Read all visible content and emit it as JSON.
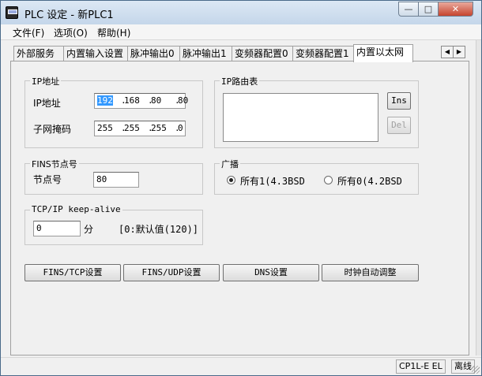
{
  "window": {
    "title": "PLC 设定 - 新PLC1",
    "minimize_glyph": "—",
    "maximize_glyph": "□",
    "close_glyph": "✕"
  },
  "menu": {
    "items": [
      "文件(F)",
      "选项(O)",
      "帮助(H)"
    ]
  },
  "tabs": {
    "items": [
      "外部服务",
      "内置输入设置",
      "脉冲输出0",
      "脉冲输出1",
      "变频器配置0",
      "变频器配置1",
      "内置以太网"
    ],
    "active_index": 6,
    "scroll_left": "◀",
    "scroll_right": "▶"
  },
  "ip_group": {
    "title": "IP地址",
    "ip_label": "IP地址",
    "ip_value": [
      "192",
      "168",
      "80",
      "80"
    ],
    "mask_label": "子网掩码",
    "mask_value": [
      "255",
      "255",
      "255",
      "0"
    ]
  },
  "route_group": {
    "title": "IP路由表",
    "ins_label": "Ins",
    "del_label": "Del"
  },
  "fins_group": {
    "title": "FINS节点号",
    "node_label": "节点号",
    "node_value": "80"
  },
  "broadcast_group": {
    "title": "广播",
    "option1": "所有1(4.3BSD",
    "option2": "所有0(4.2BSD",
    "selected": 1
  },
  "keepalive_group": {
    "title": "TCP/IP keep-alive",
    "value": "0",
    "unit": "分",
    "hint": "[0:默认值(120)]"
  },
  "buttons": {
    "fins_tcp": "FINS/TCP设置",
    "fins_udp": "FINS/UDP设置",
    "dns": "DNS设置",
    "clock": "时钟自动调整"
  },
  "status": {
    "model": "CP1L-E EL",
    "connection": "离线"
  },
  "icons": {
    "app": "plc-app-icon",
    "grip": "resize-grip-icon"
  }
}
